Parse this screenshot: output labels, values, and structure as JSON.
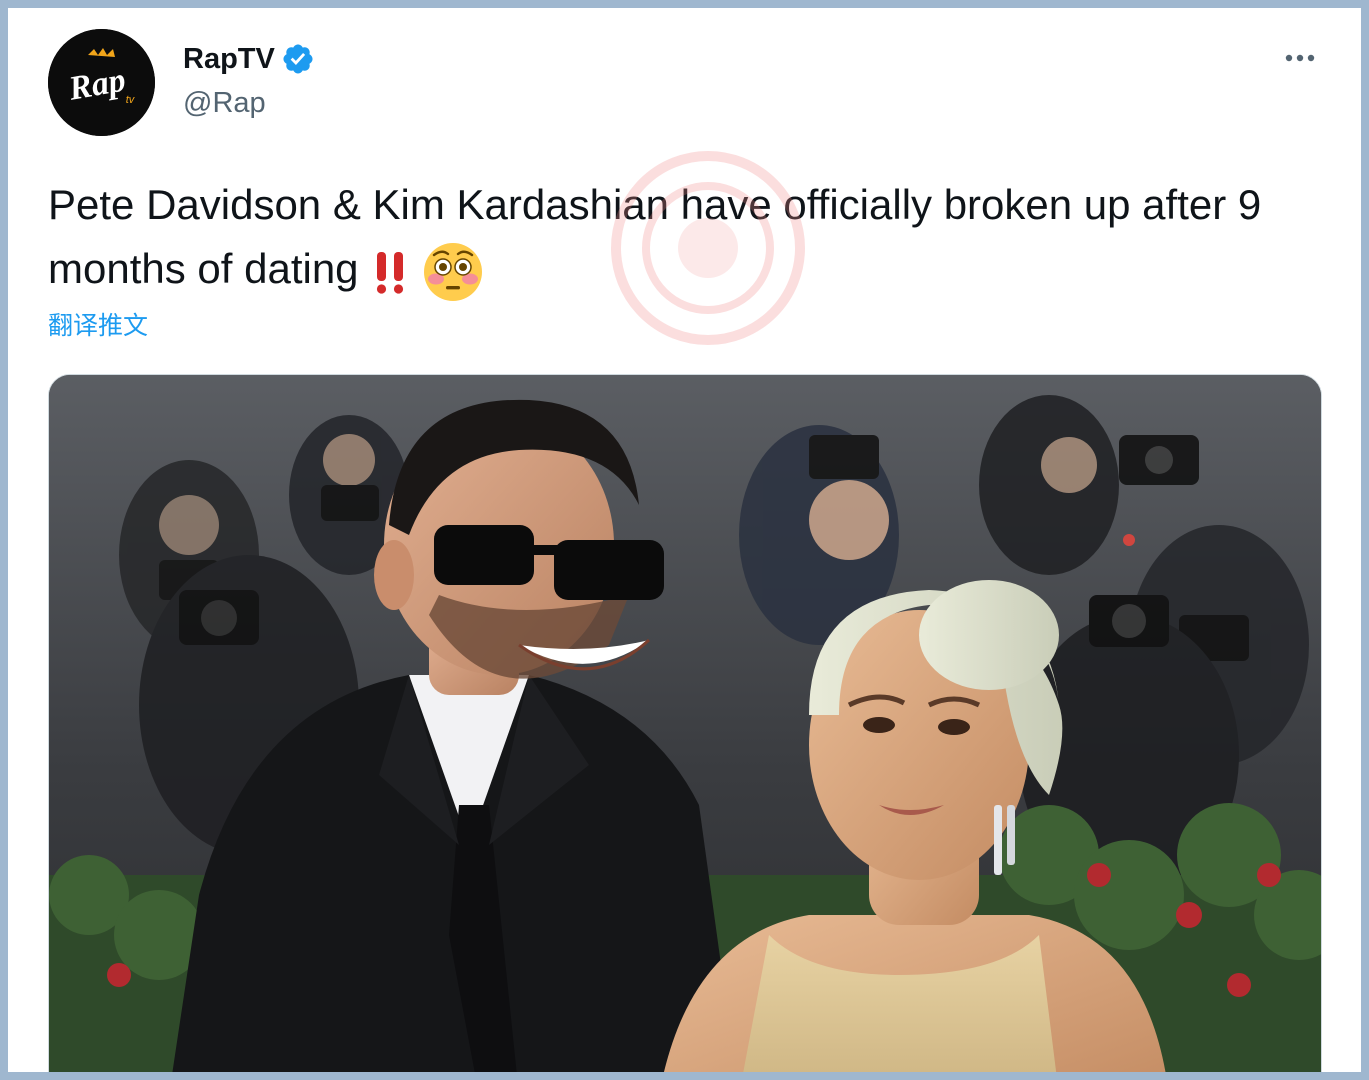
{
  "tweet": {
    "display_name": "RapTV",
    "handle": "@Rap",
    "text": "Pete Davidson & Kim Kardashian have officially broken up after 9 months of dating",
    "translate_label": "翻译推文",
    "avatar_logo_text": "Rap",
    "avatar_logo_sub": "tv"
  },
  "icons": {
    "verified": "verified-badge-icon",
    "more": "more-options-icon",
    "emoji_1": "double-exclamation-icon",
    "emoji_2": "flushed-face-icon"
  },
  "colors": {
    "accent": "#1d9bf0",
    "text": "#0f1419",
    "secondary": "#536471",
    "frame_border": "#9fb7cf"
  },
  "media": {
    "description": ""
  }
}
